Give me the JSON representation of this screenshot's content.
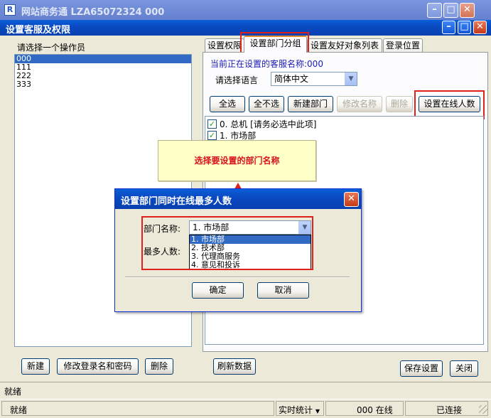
{
  "app_title": "网站商务通 LZA65072324 000",
  "dialog_title": "设置客服及权限",
  "operators": {
    "label": "请选择一个操作员",
    "items": [
      "000",
      "111",
      "222",
      "333"
    ],
    "selected_index": 0
  },
  "tabs": [
    "设置权限",
    "设置部门分组",
    "设置友好对象列表",
    "登录位置"
  ],
  "active_tab": 1,
  "current_name": "当前正在设置的客服名称:000",
  "language": {
    "label": "请选择语言",
    "value": "简体中文"
  },
  "toolbar": {
    "select_all": "全选",
    "select_none": "全不选",
    "new_dept": "新建部门",
    "rename": "修改名称",
    "delete": "删除",
    "set_online": "设置在线人数"
  },
  "departments": [
    {
      "label": "0. 总机 [请务必选中此项]",
      "checked": true
    },
    {
      "label": "1. 市场部",
      "checked": true
    }
  ],
  "callout": "选择要设置的部门名称",
  "modal": {
    "title": "设置部门同时在线最多人数",
    "dept_label": "部门名称:",
    "dept_value": "1. 市场部",
    "max_label": "最多人数:",
    "options": [
      "1. 市场部",
      "2. 技术部",
      "3. 代理商服务",
      "4. 意见和投诉"
    ],
    "ok": "确定",
    "cancel": "取消"
  },
  "bottom": {
    "new": "新建",
    "change_login": "修改登录名和密码",
    "delete": "删除",
    "refresh": "刷新数据",
    "save": "保存设置",
    "close": "关闭"
  },
  "status1": "就绪",
  "status2": {
    "left": "就绪",
    "stats": "实时统计",
    "online": "000 在线",
    "connected": "已连接"
  }
}
